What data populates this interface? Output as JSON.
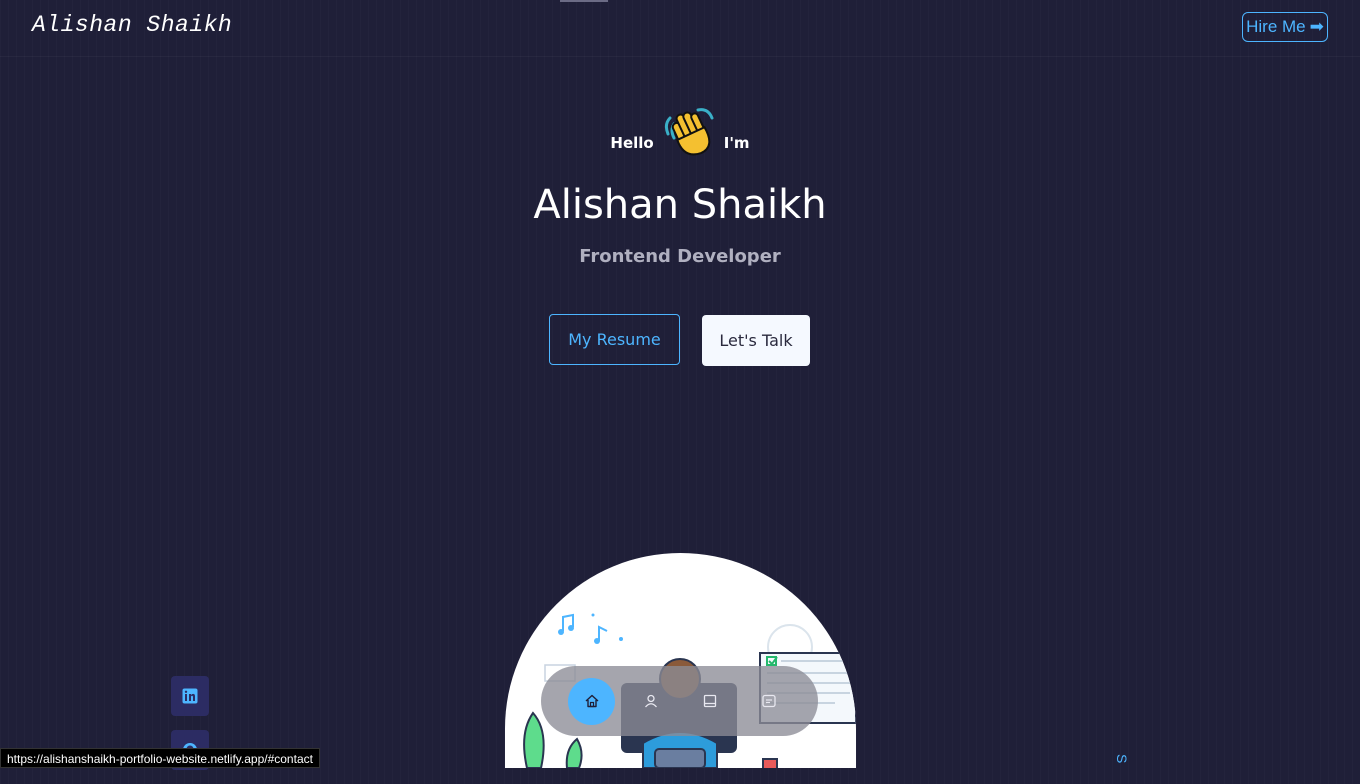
{
  "navbar": {
    "brand": "Alishan Shaikh",
    "hire_label": "Hire Me",
    "hire_icon": "arrow-right-icon"
  },
  "hero": {
    "hello": "Hello",
    "im": "I'm",
    "wave_icon": "waving-hand-icon",
    "name": "Alishan Shaikh",
    "role": "Frontend Developer",
    "resume_label": "My Resume",
    "talk_label": "Let's Talk"
  },
  "bottom_nav": {
    "items": [
      {
        "icon": "home-icon",
        "active": true
      },
      {
        "icon": "user-icon",
        "active": false
      },
      {
        "icon": "book-icon",
        "active": false
      },
      {
        "icon": "message-icon",
        "active": false
      }
    ]
  },
  "socials": [
    {
      "icon": "linkedin-icon"
    },
    {
      "icon": "github-icon"
    }
  ],
  "status_bar": {
    "url": "https://alishanshaikh-portfolio-website.netlify.app/#contact"
  },
  "side_text": "S",
  "colors": {
    "background": "#1f1f38",
    "accent": "#4db5ff",
    "social_bg": "#2c2c63"
  }
}
